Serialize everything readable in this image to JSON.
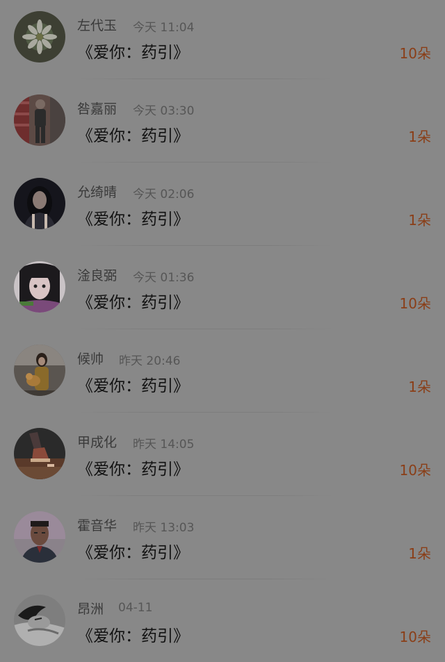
{
  "messages": [
    {
      "name": "左代玉",
      "time": "今天 11:04",
      "title": "《爱你：药引》",
      "count": "10朵",
      "avatar": "flower-photo"
    },
    {
      "name": "咎嘉丽",
      "time": "今天 03:30",
      "title": "《爱你：药引》",
      "count": "1朵",
      "avatar": "person-in-store-photo"
    },
    {
      "name": "允绮晴",
      "time": "今天 02:06",
      "title": "《爱你：药引》",
      "count": "1朵",
      "avatar": "woman-portrait-photo"
    },
    {
      "name": "淦良弼",
      "time": "今天 01:36",
      "title": "《爱你：药引》",
      "count": "10朵",
      "avatar": "girl-face-photo"
    },
    {
      "name": "候帅",
      "time": "昨天 20:46",
      "title": "《爱你：药引》",
      "count": "1朵",
      "avatar": "person-with-dog-photo"
    },
    {
      "name": "甲成化",
      "time": "昨天 14:05",
      "title": "《爱你：药引》",
      "count": "10朵",
      "avatar": "shoes-photo"
    },
    {
      "name": "霍音华",
      "time": "昨天 13:03",
      "title": "《爱你：药引》",
      "count": "1朵",
      "avatar": "man-portrait-photo"
    },
    {
      "name": "昂洲",
      "time": "04-11",
      "title": "《爱你：药引》",
      "count": "10朵",
      "avatar": "sleeping-person-photo"
    }
  ]
}
